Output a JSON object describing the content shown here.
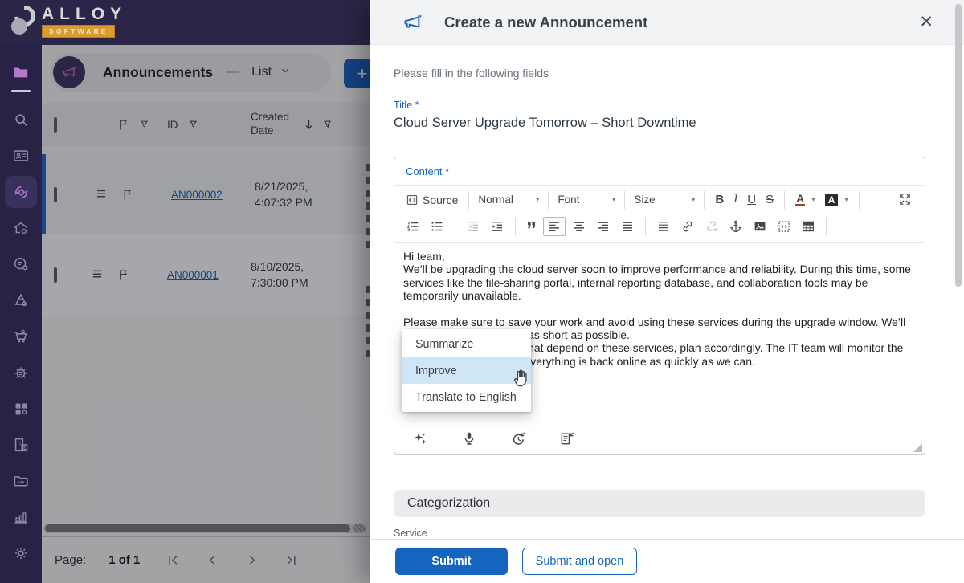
{
  "colors": {
    "accent_blue": "#1565c0",
    "topbar_purple": "#2b2647",
    "sidebar_purple": "#282344",
    "logo_orange": "#dc9b2d",
    "pink_accent": "#c06ec4",
    "menu_highlight": "#cfe6f6",
    "selected_row_bar": "#1f64c8"
  },
  "topbar": {
    "logo_line1": "ALLOY",
    "logo_line2": "SOFTWARE"
  },
  "sidebar": {
    "icons": [
      "folder",
      "search",
      "id-badge",
      "automation-gear",
      "home-gear",
      "service-config",
      "hierarchy-gear",
      "procurement-cart",
      "network-hub",
      "apps-grid",
      "organization",
      "directories",
      "reports",
      "settings"
    ],
    "active_icon": "automation-gear"
  },
  "list_pane": {
    "header": {
      "title": "Announcements",
      "separator": "—",
      "view": "List",
      "add_button": "+"
    },
    "table": {
      "id_header": "ID",
      "created_header": "Created Date",
      "rows": [
        {
          "id": "AN000002",
          "created_line1": "8/21/2025,",
          "created_line2": "4:07:32 PM"
        },
        {
          "id": "AN000001",
          "created_line1": "8/10/2025,",
          "created_line2": "7:30:00 PM"
        }
      ]
    },
    "pagination": {
      "label": "Page:",
      "value": "1 of 1",
      "icons": [
        "first-page",
        "prev-page",
        "next-page",
        "last-page"
      ]
    }
  },
  "modal": {
    "title": "Create a new Announcement",
    "close_glyph": "✕",
    "subtitle": "Please fill in the following fields",
    "title_field": {
      "label": "Title *",
      "value": "Cloud Server Upgrade Tomorrow – Short Downtime"
    },
    "content_field": {
      "label": "Content *"
    },
    "editor": {
      "source_label": "Source",
      "paragraph_format": "Normal",
      "font_label": "Font",
      "size_label": "Size",
      "bold": "B",
      "italic": "I",
      "underline": "U",
      "strike": "S",
      "text_color_letter": "A",
      "bg_color_letter": "A",
      "quote_glyph": "”",
      "caret_glyph": "▾",
      "toolbar_row2_icons": [
        "numbered-list",
        "bulleted-list",
        "decrease-indent",
        "increase-indent",
        "blockquote",
        "align-left",
        "align-center",
        "align-right",
        "justify",
        "line-spacing",
        "insert-link",
        "unlink",
        "anchor",
        "insert-image",
        "code-snippet",
        "insert-table"
      ],
      "footer_icons": [
        "ai-sparkles",
        "microphone",
        "insert-history",
        "insert-template"
      ],
      "lines": [
        "Hi team,",
        "We’ll be upgrading the cloud server soon to improve performance and reliability. During this time, some services like the file-sharing portal, internal reporting database, and collaboration tools may be temporarily unavailable.",
        "Please make sure to save your work and avoid using these services during the upgrade window. We’ll try to keep the downtime as short as possible.",
        "If you have critical tasks that depend on these services, plan accordingly. The IT team will monitor the upgrade and make sure everything is back online as quickly as we can."
      ]
    },
    "ai_menu": {
      "items": [
        "Summarize",
        "Improve",
        "Translate to English"
      ],
      "highlighted": "Improve"
    },
    "categorization_header": "Categorization",
    "service_label": "Service",
    "footer": {
      "submit": "Submit",
      "submit_and_open": "Submit and open"
    }
  }
}
